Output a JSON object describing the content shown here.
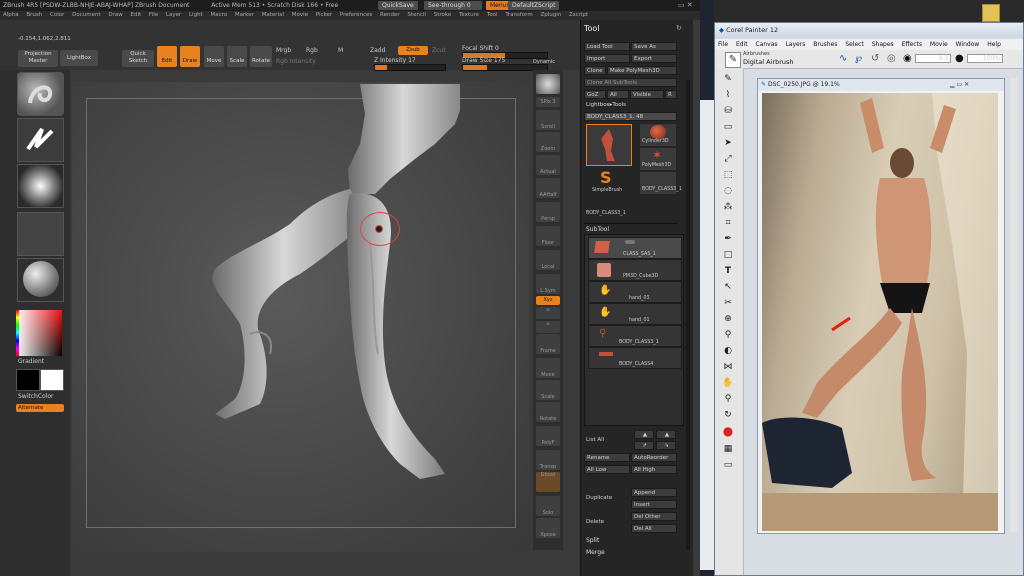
{
  "zbrush": {
    "title": "ZBrush 4R5  [PSDW-ZLBB-NHJE-ABAJ-WHAP]    ZBrush Document",
    "status": "Active Mem 513  •  Scratch Disk 166  •  Free",
    "toolbar_buttons": {
      "quicksave": "QuickSave",
      "seethrough": "See-through  0",
      "menus": "Menus",
      "script": "DefaultZScript"
    },
    "menu": [
      "Alpha",
      "Brush",
      "Color",
      "Document",
      "Draw",
      "Edit",
      "File",
      "Layer",
      "Light",
      "Macro",
      "Marker",
      "Material",
      "Movie",
      "Picker",
      "Preferences",
      "Render",
      "Stencil",
      "Stroke",
      "Texture",
      "Tool",
      "Transform",
      "Zplugin",
      "Zscript"
    ],
    "coords": "-0.154,1.062,2.811",
    "projection_master": "Projection Master",
    "lightbox": "LightBox",
    "quick_sketch": "Quick Sketch",
    "modes": {
      "edit": "Edit",
      "draw": "Draw",
      "move": "Move",
      "scale": "Scale",
      "rotate": "Rotate"
    },
    "mrgb": {
      "mrgb": "Mrgb",
      "rgb": "Rgb",
      "m": "M",
      "rgb_intensity": "Rgb Intensity"
    },
    "zadd": "Zadd",
    "zsub": "Zsub",
    "zcut": "Zcut",
    "z_intensity": {
      "label": "Z Intensity",
      "value": "17",
      "level": 0.17
    },
    "focal_shift": {
      "label": "Focal Shift",
      "value": "0",
      "level": 0.5
    },
    "draw_size": {
      "label": "Draw Size",
      "value": "175",
      "level": 0.28
    },
    "dynamic": "Dynamic",
    "left_shelf": {
      "gradient": "Gradient",
      "switch_color": "SwitchColor",
      "alternate": "Alternate"
    },
    "right_column": [
      "SPix 3",
      "Scroll",
      "Zoom",
      "Actual",
      "AAHalf",
      "Persp",
      "Floor",
      "Local",
      "L.Sym",
      "Xyz",
      "",
      "",
      "Frame",
      "Move",
      "Scale",
      "Rotate",
      "PolyF",
      "Transp",
      "Ghost",
      "Solo",
      "Xpose"
    ],
    "tool_palette": {
      "header": "Tool",
      "buttons": [
        [
          "Load Tool",
          "Save As"
        ],
        [
          "Import",
          "Export"
        ],
        [
          "Clone",
          "Make PolyMesh3D"
        ],
        [
          "GoZ",
          "All",
          "Visible",
          "R"
        ]
      ],
      "lightbox_tools": "Lightbox▸Tools",
      "current_tool": "BODY_CLASS3_1. 48",
      "tool_thumbs": [
        "Cylinder3D",
        "PolyMesh3D",
        "SimpleBrush",
        "BODY_CLASS3_1"
      ],
      "current_tool_label": "BODY_CLASS3_1",
      "subtool_header": "SubTool",
      "subtools": [
        "CLASS_SAS_1",
        "PM3D_Cube3D",
        "hand_03",
        "hand_01",
        "BODY_CLASS3_1",
        "BODY_CLASS4"
      ],
      "list_all": "List All",
      "rename": "Rename",
      "autoreorder": "AutoReorder",
      "all_low": "All Low",
      "all_high": "All High",
      "duplicate": "Duplicate",
      "append": "Append",
      "insert": "Insert",
      "delete": "Delete",
      "del_other": "Del Other",
      "del_all": "Del All",
      "split": "Split",
      "merge": "Merge"
    }
  },
  "painter": {
    "title": "Corel Painter 12",
    "menu": [
      "File",
      "Edit",
      "Canvas",
      "Layers",
      "Brushes",
      "Select",
      "Shapes",
      "Effects",
      "Movie",
      "Window",
      "Help"
    ],
    "brush_category": "Airbrushes",
    "brush_variant": "Digital Airbrush",
    "size_value": "4.3",
    "opacity_value": "100%",
    "doc_title": "DSC_0250.JPG @ 19.1%"
  },
  "colors": {
    "accent": "#e8821f",
    "zbrush_bg": "#3a3a3a",
    "painter_bg": "#d8dde3"
  }
}
